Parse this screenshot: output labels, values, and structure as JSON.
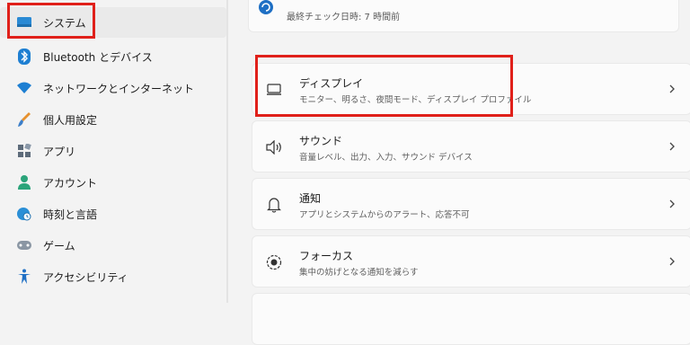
{
  "sidebar": {
    "items": [
      {
        "label": "システム",
        "icon": "system-display-icon",
        "selected": true
      },
      {
        "label": "Bluetooth とデバイス",
        "icon": "bluetooth-icon"
      },
      {
        "label": "ネットワークとインターネット",
        "icon": "wifi-icon"
      },
      {
        "label": "個人用設定",
        "icon": "paintbrush-icon"
      },
      {
        "label": "アプリ",
        "icon": "apps-icon"
      },
      {
        "label": "アカウント",
        "icon": "person-icon"
      },
      {
        "label": "時刻と言語",
        "icon": "globe-clock-icon"
      },
      {
        "label": "ゲーム",
        "icon": "gamepad-icon"
      },
      {
        "label": "アクセシビリティ",
        "icon": "accessibility-icon"
      }
    ]
  },
  "main": {
    "update_check": "最終チェック日時: 7 時間前",
    "cards": [
      {
        "title": "ディスプレイ",
        "subtitle": "モニター、明るさ、夜間モード、ディスプレイ プロファイル",
        "icon": "monitor-icon"
      },
      {
        "title": "サウンド",
        "subtitle": "音量レベル、出力、入力、サウンド デバイス",
        "icon": "speaker-icon"
      },
      {
        "title": "通知",
        "subtitle": "アプリとシステムからのアラート、応答不可",
        "icon": "bell-icon"
      },
      {
        "title": "フォーカス",
        "subtitle": "集中の妨げとなる通知を減らす",
        "icon": "focus-icon"
      }
    ]
  },
  "colors": {
    "accent": "#0067c0",
    "highlight": "#e0201a",
    "background": "#f3f3f3",
    "card": "#fbfbfb"
  }
}
